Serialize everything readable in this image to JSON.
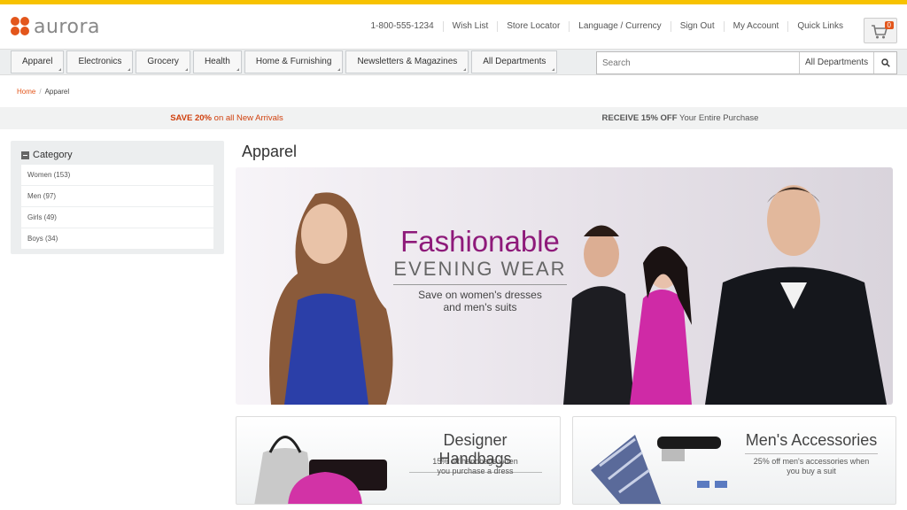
{
  "brand": {
    "name": "aurora",
    "accent": "#e3561b",
    "topbar_color": "#f7c200"
  },
  "utility_links": [
    "1-800-555-1234",
    "Wish List",
    "Store Locator",
    "Language / Currency",
    "Sign Out",
    "My Account",
    "Quick Links"
  ],
  "cart": {
    "count": "0",
    "icon": "shopping-cart-icon"
  },
  "nav": [
    "Apparel",
    "Electronics",
    "Grocery",
    "Health",
    "Home & Furnishing",
    "Newsletters & Magazines",
    "All Departments"
  ],
  "search": {
    "placeholder": "Search",
    "department": "All Departments",
    "icon": "search-icon"
  },
  "breadcrumb": {
    "home": "Home",
    "sep": "/",
    "current": "Apparel"
  },
  "promo": {
    "left_strong": "SAVE 20%",
    "left_rest": " on all New Arrivals",
    "right_strong": "RECEIVE 15% OFF",
    "right_rest": " Your Entire Purchase"
  },
  "sidebar": {
    "title": "Category",
    "items": [
      "Women (153)",
      "Men (97)",
      "Girls (49)",
      "Boys (34)"
    ]
  },
  "page_title": "Apparel",
  "hero": {
    "title": "Fashionable",
    "subtitle": "EVENING WEAR",
    "desc_line1": "Save on women's dresses",
    "desc_line2": "and men's suits"
  },
  "tiles": [
    {
      "title": "Designer Handbags",
      "desc_line1": "15% off handbags when",
      "desc_line2": "you purchase a dress"
    },
    {
      "title": "Men's Accessories",
      "desc_line1": "25% off men's accessories when",
      "desc_line2": "you buy a suit"
    }
  ]
}
